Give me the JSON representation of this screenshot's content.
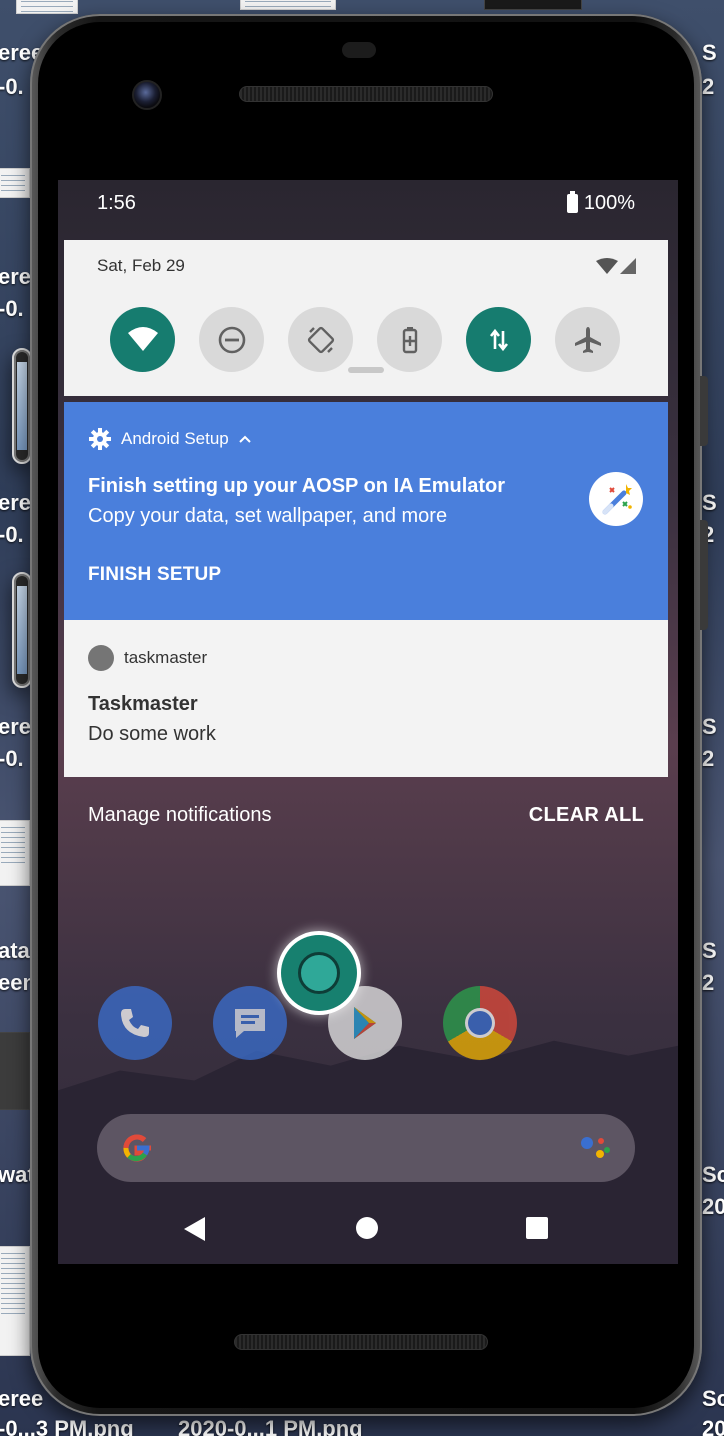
{
  "desktop": {
    "labels_left": [
      "eree",
      "-0.",
      "eree",
      "-0.",
      "eree",
      "-0.",
      "eree",
      "-0.",
      "ata",
      "een",
      "wat",
      "eree",
      "-0...3 PM.png"
    ],
    "labels_right": [
      "S",
      "2",
      "S",
      "2",
      "S",
      "2",
      "S",
      "2",
      "Sc",
      "20",
      "Sc",
      "20"
    ],
    "label_bottom_middle": "2020-0...1 PM.png"
  },
  "status_bar": {
    "time": "1:56",
    "battery": "100%"
  },
  "quick_settings": {
    "date": "Sat, Feb 29",
    "tiles": [
      {
        "name": "wifi-tile",
        "icon": "wifi-icon",
        "on": true
      },
      {
        "name": "do-not-disturb-tile",
        "icon": "do-not-disturb-icon",
        "on": false
      },
      {
        "name": "auto-rotate-tile",
        "icon": "auto-rotate-icon",
        "on": false
      },
      {
        "name": "battery-saver-tile",
        "icon": "battery-saver-icon",
        "on": false
      },
      {
        "name": "mobile-data-tile",
        "icon": "mobile-data-icon",
        "on": true
      },
      {
        "name": "airplane-mode-tile",
        "icon": "airplane-icon",
        "on": false
      }
    ]
  },
  "notifications": {
    "setup": {
      "app_name": "Android Setup",
      "title": "Finish setting up your AOSP on IA Emulator",
      "text": "Copy your data, set wallpaper, and more",
      "action": "FINISH SETUP",
      "color": "#4a7fdc"
    },
    "taskmaster": {
      "app_name": "taskmaster",
      "title": "Taskmaster",
      "text": "Do some work"
    }
  },
  "footer": {
    "manage": "Manage notifications",
    "clear_all": "CLEAR ALL"
  },
  "home": {
    "dock": [
      "phone-icon",
      "messages-icon",
      "play-store-icon",
      "chrome-icon"
    ],
    "search": {
      "logo": "google-g-icon",
      "assistant": "assistant-icon"
    }
  },
  "nav": [
    "back-icon",
    "home-icon",
    "recents-icon"
  ],
  "colors": {
    "accent": "#167c6f",
    "tile_off": "#d9d9d9",
    "panel": "#f2f2f2"
  }
}
